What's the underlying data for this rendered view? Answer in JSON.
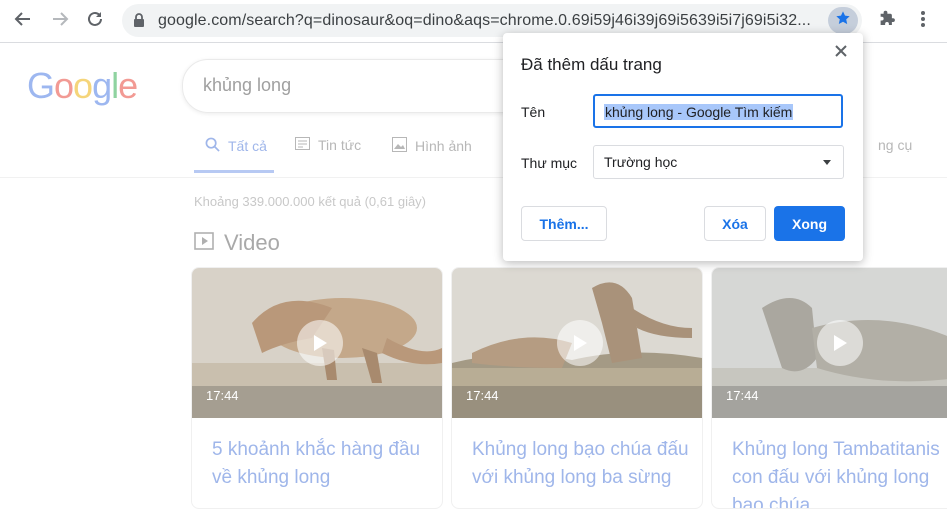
{
  "browser": {
    "url": "google.com/search?q=dinosaur&oq=dino&aqs=chrome.0.69i59j46i39j69i5639i5i7j69i5i32...",
    "icons": {
      "back": "arrow-left-icon",
      "forward": "arrow-right-icon",
      "reload": "reload-icon",
      "lock": "lock-icon",
      "bookmark": "star-icon",
      "extensions": "puzzle-icon",
      "menu": "kebab-menu-icon"
    }
  },
  "google": {
    "logo": [
      "G",
      "o",
      "o",
      "g",
      "l",
      "e"
    ],
    "logo_colors": [
      "#9db7f0",
      "#f29a94",
      "#f5d57a",
      "#9db7f0",
      "#8fd3a0",
      "#f29a94"
    ],
    "query": "khủng long",
    "tabs": [
      {
        "label": "Tất cả",
        "icon": "search-icon"
      },
      {
        "label": "Tin tức",
        "icon": "news-icon"
      },
      {
        "label": "Hình ảnh",
        "icon": "image-icon"
      },
      {
        "label": "ng cụ"
      }
    ],
    "stats": "Khoảng 339.000.000 kết quả (0,61 giây)",
    "video_heading": "Video",
    "videos": [
      {
        "duration": "17:44",
        "title": "5 khoảnh khắc hàng đầu về khủng long"
      },
      {
        "duration": "17:44",
        "title": "Khủng long bạo chúa đấu với khủng long ba sừng"
      },
      {
        "duration": "17:44",
        "title": "Khủng long Tambatitanis con đấu với khủng long bạo chúa"
      }
    ]
  },
  "dialog": {
    "title": "Đã thêm dấu trang",
    "name_label": "Tên",
    "name_value": "khủng long - Google Tìm kiếm",
    "folder_label": "Thư mục",
    "folder_value": "Trường học",
    "more_button": "Thêm...",
    "remove_button": "Xóa",
    "done_button": "Xong"
  },
  "colors": {
    "accent": "#1a73e8",
    "selection": "#a8c7fa"
  }
}
